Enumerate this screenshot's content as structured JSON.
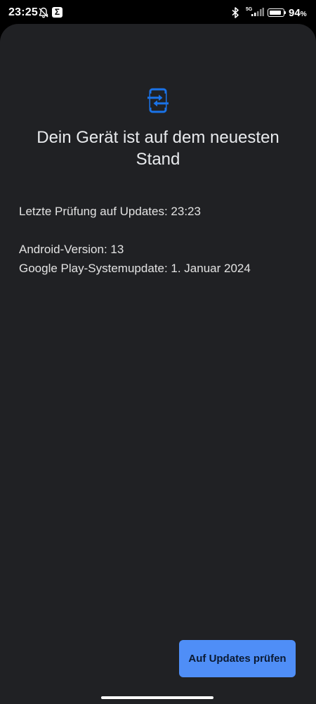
{
  "status_bar": {
    "time": "23:25",
    "network": "5G",
    "battery_percent": 94,
    "battery_label": "94",
    "battery_unit": "%",
    "icons": [
      "bell-off-icon",
      "sigma-app-icon",
      "bluetooth-icon",
      "signal-icon",
      "battery-icon"
    ]
  },
  "main": {
    "icon": "system-update-icon",
    "title": "Dein Gerät ist auf dem neuesten Stand",
    "last_check": "Letzte Prüfung auf Updates: 23:23",
    "android_version": "Android-Version: 13",
    "play_update": "Google Play-Systemupdate: 1. Januar 2024",
    "check_button_label": "Auf Updates prüfen"
  },
  "colors": {
    "background": "#202124",
    "accent": "#4f8ef7",
    "icon": "#1a73e8"
  }
}
